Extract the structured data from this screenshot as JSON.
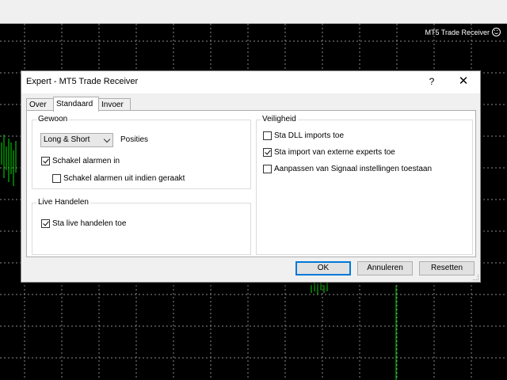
{
  "chart": {
    "label": "MT5 Trade Receiver",
    "status_icon": "smiley-icon"
  },
  "dialog": {
    "title": "Expert - MT5 Trade Receiver",
    "help": "?",
    "close": "✕",
    "tabs": [
      "Over",
      "Standaard",
      "Invoer"
    ],
    "active_tab": "Standaard",
    "gewoon": {
      "legend": "Gewoon",
      "select_value": "Long & Short",
      "select_label": "Posities",
      "alarm_label": "Schakel alarmen in",
      "alarm_checked": true,
      "alarm_off_label": "Schakel alarmen uit indien geraakt",
      "alarm_off_checked": false
    },
    "live": {
      "legend": "Live Handelen",
      "allow_label": "Sta live handelen toe",
      "allow_checked": true
    },
    "veiligheid": {
      "legend": "Veiligheid",
      "dll_label": "Sta DLL imports toe",
      "dll_checked": false,
      "import_label": "Sta import van externe experts toe",
      "import_checked": true,
      "signal_label": "Aanpassen van Signaal instellingen toestaan",
      "signal_checked": false
    },
    "buttons": {
      "ok": "OK",
      "cancel": "Annuleren",
      "reset": "Resetten"
    }
  }
}
